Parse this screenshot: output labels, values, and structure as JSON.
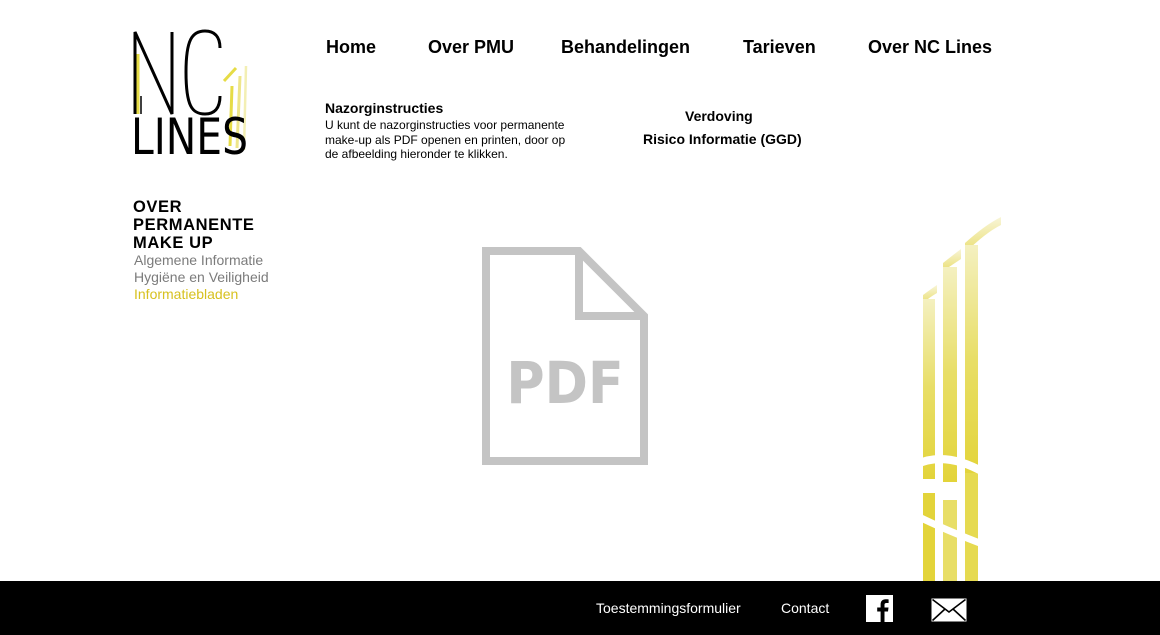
{
  "brand": {
    "logo_line1": "NC",
    "logo_line2": "LINES",
    "accent_color": "#e2d63c"
  },
  "nav": {
    "items": [
      {
        "label": "Home"
      },
      {
        "label": "Over PMU"
      },
      {
        "label": "Behandelingen"
      },
      {
        "label": "Tarieven"
      },
      {
        "label": "Over NC Lines"
      }
    ]
  },
  "info": {
    "title": "Nazorginstructies",
    "text": "U kunt de nazorginstructies voor permanente make-up als PDF openen en printen, door op de afbeelding hieronder te klikken.",
    "links": [
      {
        "label": "Verdoving"
      },
      {
        "label": "Risico Informatie (GGD)"
      }
    ]
  },
  "sidebar": {
    "heading": "OVER PERMANENTE MAKE UP",
    "items": [
      {
        "label": "Algemene Informatie",
        "active": false
      },
      {
        "label": "Hygiëne en Veiligheid",
        "active": false
      },
      {
        "label": "Informatiebladen",
        "active": true
      }
    ],
    "active_color": "#d7c11f"
  },
  "pdf": {
    "icon": "pdf-file-icon",
    "label": "PDF"
  },
  "footer": {
    "links": [
      {
        "label": "Toestemmingsformulier"
      },
      {
        "label": "Contact"
      }
    ],
    "icons": [
      "facebook-icon",
      "mail-icon"
    ]
  }
}
